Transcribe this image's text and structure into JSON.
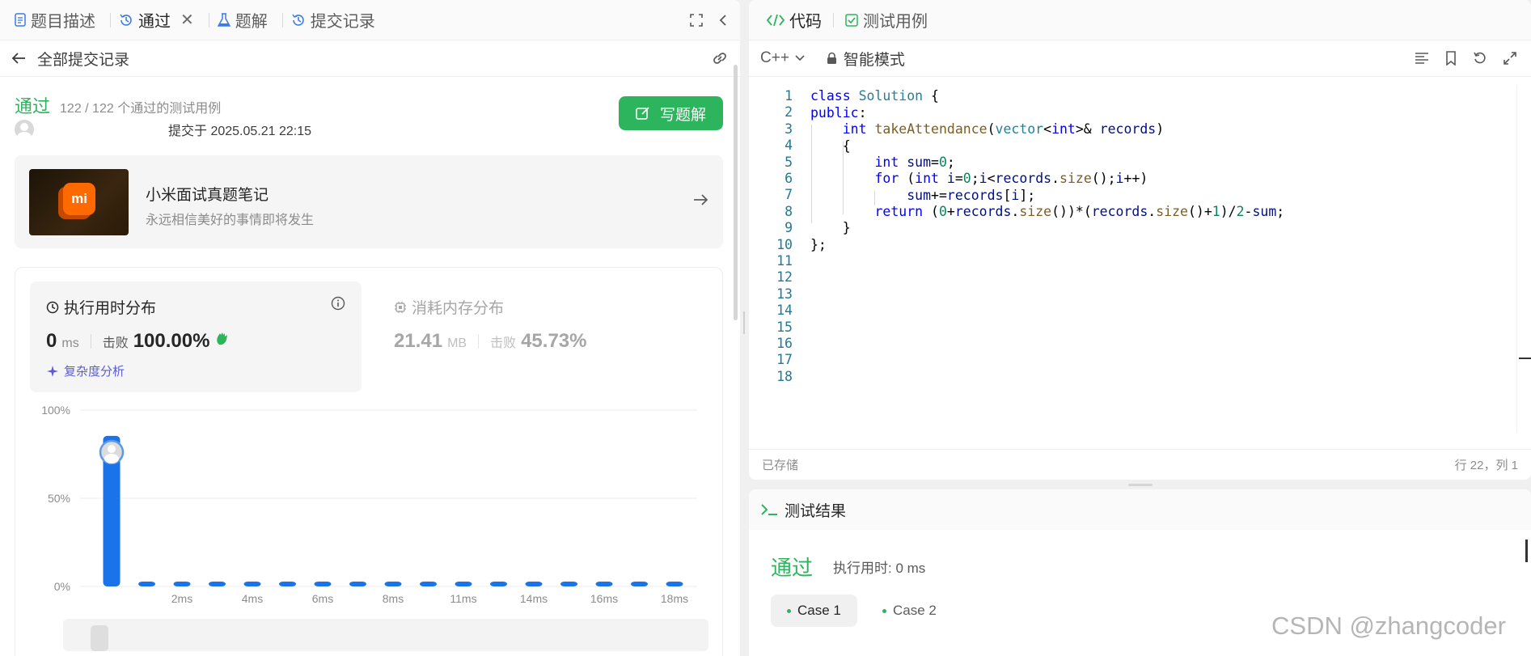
{
  "left_tabs": [
    {
      "label": "题目描述"
    },
    {
      "label": "通过"
    },
    {
      "label": "题解"
    },
    {
      "label": "提交记录"
    }
  ],
  "sub_header": {
    "title": "全部提交记录"
  },
  "submission": {
    "status": "通过",
    "cases": "122 / 122 个通过的测试用例",
    "submitted_at": "提交于 2025.05.21 22:15",
    "write_button": "写题解"
  },
  "promo": {
    "title": "小米面试真题笔记",
    "subtitle": "永远相信美好的事情即将发生",
    "logo": "mi"
  },
  "runtime": {
    "title": "执行用时分布",
    "value": "0",
    "unit": "ms",
    "beat_label": "击败",
    "beat_value": "100.00%",
    "analysis": "复杂度分析"
  },
  "memory": {
    "title": "消耗内存分布",
    "value": "21.41",
    "unit": "MB",
    "beat_label": "击败",
    "beat_value": "45.73%"
  },
  "chart_data": {
    "type": "bar",
    "y_ticks": [
      "100%",
      "50%",
      "0%"
    ],
    "ylim": [
      0,
      100
    ],
    "x_tick_labels": [
      "2ms",
      "4ms",
      "6ms",
      "8ms",
      "11ms",
      "14ms",
      "16ms",
      "18ms"
    ],
    "values": [
      85.4,
      1.5,
      1.5,
      1.5,
      1.5,
      1.5,
      1.5,
      1.5,
      1.5,
      1.5,
      1.5,
      1.5,
      1.5,
      1.5,
      1.5,
      1.5,
      1.5
    ],
    "highlight_index": 0,
    "color": "#1a73e8"
  },
  "editor": {
    "tabs": [
      {
        "label": "代码"
      },
      {
        "label": "测试用例"
      }
    ],
    "language": "C++",
    "mode": "智能模式",
    "saved": "已存储",
    "cursor": "行 22，列 1",
    "line_numbers": [
      "1",
      "2",
      "3",
      "4",
      "5",
      "6",
      "7",
      "8",
      "9",
      "10",
      "11",
      "12",
      "13",
      "14",
      "15",
      "16",
      "17",
      "18"
    ]
  },
  "result": {
    "title": "测试结果",
    "status": "通过",
    "runtime": "执行用时: 0 ms",
    "cases": [
      "Case 1",
      "Case 2"
    ]
  },
  "watermark": "CSDN @zhangcoder",
  "colors": {
    "accent_green": "#2cb55d",
    "bar_blue": "#1a73e8",
    "link_purple": "#5b5bd6"
  }
}
